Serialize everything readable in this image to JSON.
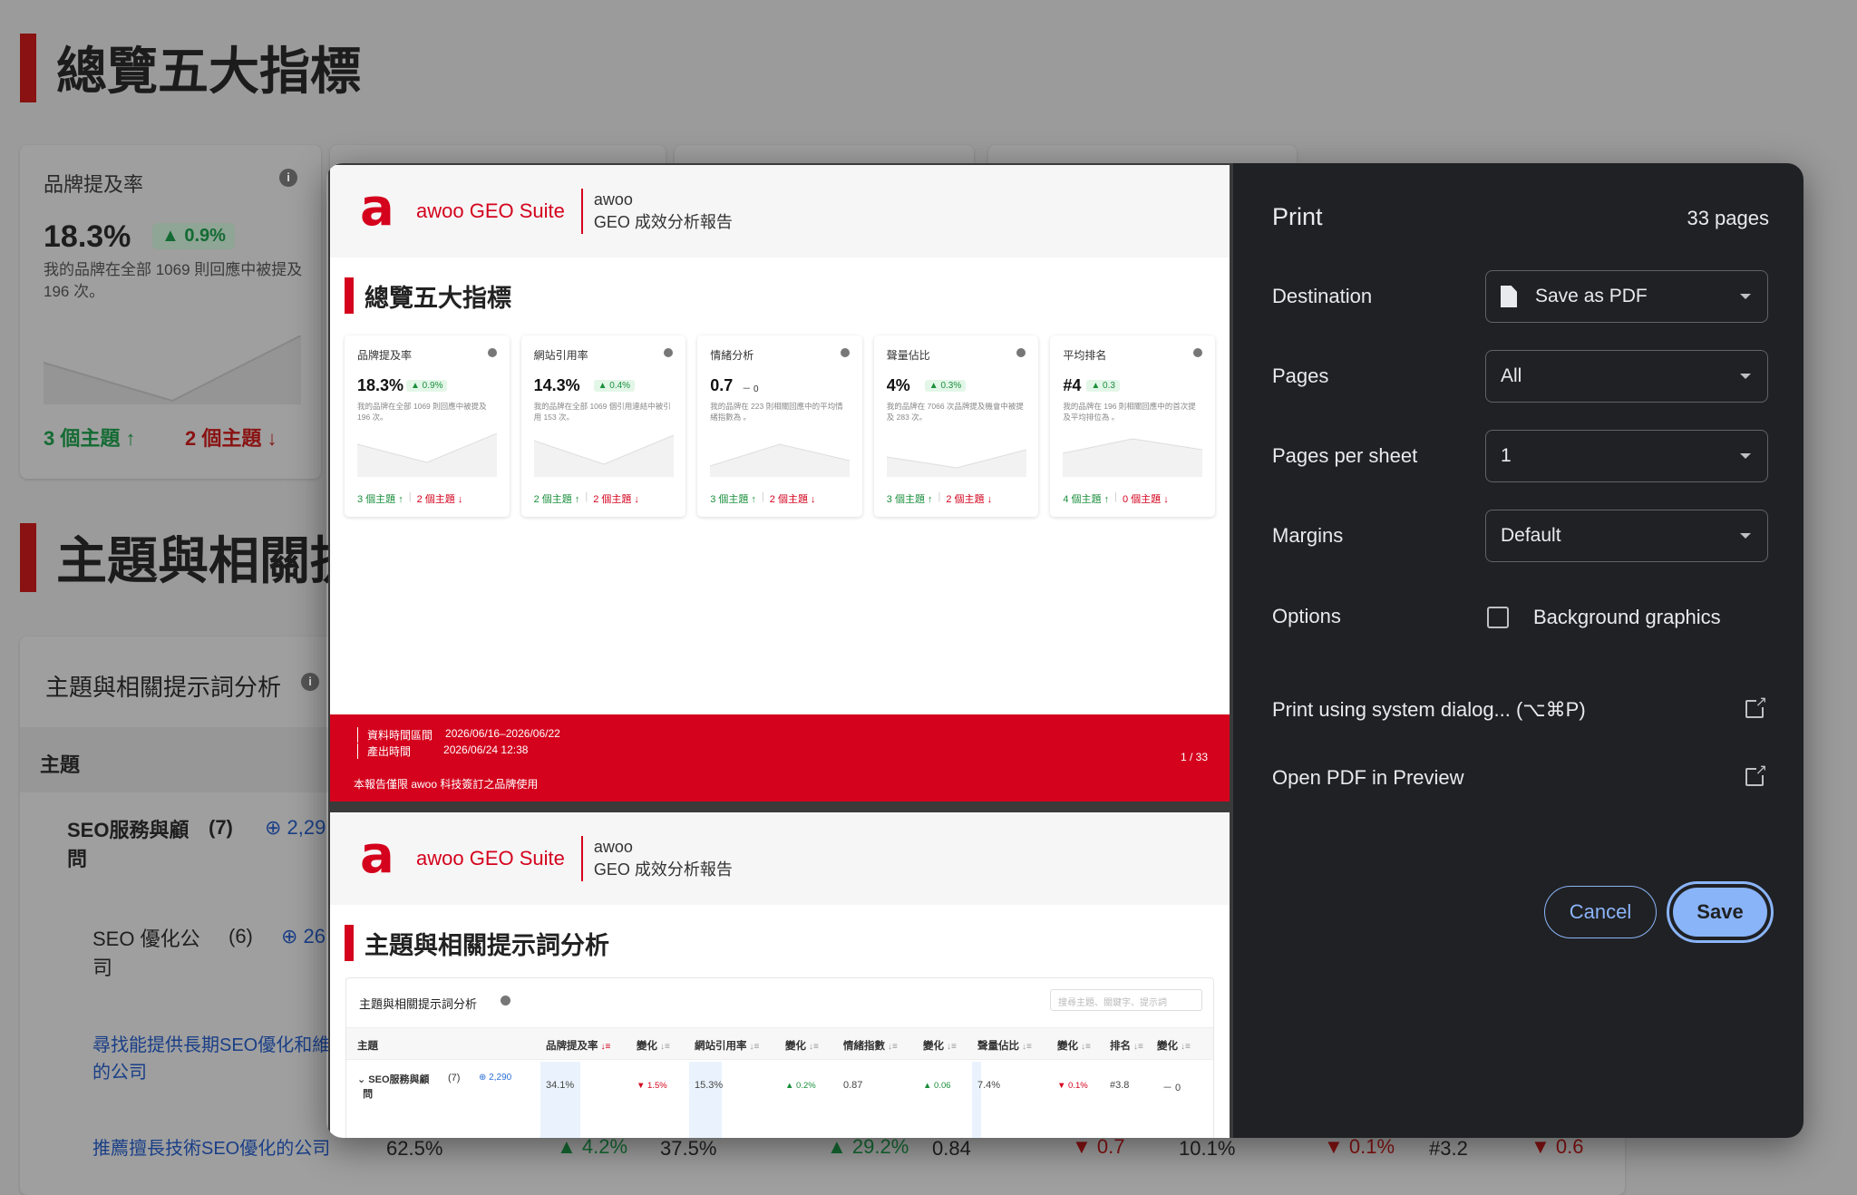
{
  "background": {
    "section1_title": "總覽五大指標",
    "metric": {
      "label": "品牌提及率",
      "value": "18.3%",
      "change": "▲ 0.9%",
      "desc": "我的品牌在全部 1069 則回應中被提及 196 次。",
      "up_topics": "3 個主題 ↑",
      "down_topics": "2 個主題 ↓"
    },
    "section2_title": "主題與相關提",
    "topic_card_title": "主題與相關提示詞分析",
    "column_topic": "主題",
    "row1": {
      "name_line1": "SEO服務與顧",
      "name_line2": "問",
      "count": "(7)",
      "badge": "2,29"
    },
    "row2": {
      "name_line1": "SEO 優化公",
      "name_line2": "司",
      "count": "(6)",
      "badge": "26"
    },
    "link1_line1": "尋找能提供長期SEO優化和維",
    "link1_line2": "的公司",
    "link2": "推薦擅長技術SEO優化的公司",
    "bottom_row": {
      "v1": "62.5%",
      "c1": "▲ 4.2%",
      "v2": "37.5%",
      "c2": "▲ 29.2%",
      "v3": "0.84",
      "c3": "▼ 0.7",
      "v4": "10.1%",
      "c4": "▼ 0.1%",
      "v5": "#3.2",
      "c5": "▼ 0.6"
    }
  },
  "preview": {
    "brand": "awoo GEO Suite",
    "logo_glyph": "a",
    "header_line1": "awoo",
    "header_line2": "GEO 成效分析報告",
    "page1_title": "總覽五大指標",
    "cards": [
      {
        "label": "品牌提及率",
        "value": "18.3%",
        "change": "▲ 0.9%",
        "flat": false,
        "desc": "我的品牌在全部 1069 則回應中被提及 196 次。",
        "up": "3 個主題 ↑",
        "down": "2 個主題 ↓"
      },
      {
        "label": "網站引用率",
        "value": "14.3%",
        "change": "▲ 0.4%",
        "flat": false,
        "desc": "我的品牌在全部 1069 個引用連結中被引用 153 次。",
        "up": "2 個主題 ↑",
        "down": "2 個主題 ↓"
      },
      {
        "label": "情緒分析",
        "value": "0.7",
        "change": "－ 0",
        "flat": true,
        "desc": "我的品牌在 223 則相關回應中的平均情緒指數為 。",
        "up": "3 個主題 ↑",
        "down": "2 個主題 ↓"
      },
      {
        "label": "聲量佔比",
        "value": "4%",
        "change": "▲ 0.3%",
        "flat": false,
        "desc": "我的品牌在 7066 次品牌提及機會中被提及 283 次。",
        "up": "3 個主題 ↑",
        "down": "2 個主題 ↓"
      },
      {
        "label": "平均排名",
        "value": "#4",
        "change": "▲ 0.3",
        "flat": false,
        "desc": "我的品牌在 196 則相關回應中的首次提及平均排位為 。",
        "up": "4 個主題 ↑",
        "down": "0 個主題 ↓"
      }
    ],
    "footer": {
      "range_label": "資料時間區間",
      "range_value": "2026/06/16–2026/06/22",
      "generated_label": "產出時間",
      "generated_value": "2026/06/24 12:38",
      "note": "本報告僅限 awoo 科技簽訂之品牌使用",
      "page": "1 / 33"
    },
    "page2_title": "主題與相關提示詞分析",
    "table": {
      "title": "主題與相關提示詞分析",
      "search_placeholder": "搜尋主題、關鍵字、提示詞",
      "headers": [
        "主題",
        "品牌提及率",
        "變化",
        "網站引用率",
        "變化",
        "情緒指數",
        "變化",
        "聲量佔比",
        "變化",
        "排名",
        "變化"
      ],
      "row": {
        "topic_line1": "SEO服務與顧",
        "topic_line2": "問",
        "count": "(7)",
        "badge": "2,290",
        "cells": [
          "34.1%",
          "▼ 1.5%",
          "15.3%",
          "▲ 0.2%",
          "0.87",
          "▲ 0.06",
          "7.4%",
          "▼ 0.1%",
          "#3.8",
          "－ 0"
        ]
      }
    }
  },
  "print": {
    "title": "Print",
    "page_count": "33 pages",
    "destination_label": "Destination",
    "destination_value": "Save as PDF",
    "pages_label": "Pages",
    "pages_value": "All",
    "per_sheet_label": "Pages per sheet",
    "per_sheet_value": "1",
    "margins_label": "Margins",
    "margins_value": "Default",
    "options_label": "Options",
    "background_graphics": "Background graphics",
    "background_graphics_checked": false,
    "system_dialog": "Print using system dialog... (⌥⌘P)",
    "open_preview": "Open PDF in Preview",
    "cancel": "Cancel",
    "save": "Save",
    "accent_color": "#8ab4f8"
  }
}
